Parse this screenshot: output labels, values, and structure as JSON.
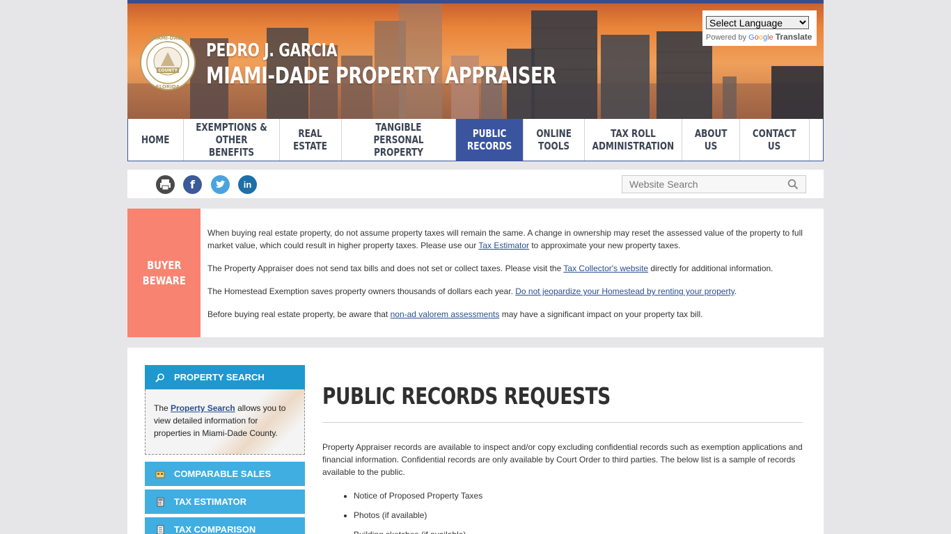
{
  "header": {
    "appraiser_name": "PEDRO J. GARCIA",
    "office_name": "MIAMI-DADE PROPERTY APPRAISER",
    "seal_top_text": "MIAMI-DADE",
    "seal_mid_text": "COUNTY",
    "seal_bottom_text": "FLORIDA",
    "translate": {
      "select_label": "Select Language",
      "powered_by": "Powered by",
      "google": "Google",
      "translate_label": "Translate"
    }
  },
  "nav": {
    "items": [
      {
        "label": "HOME"
      },
      {
        "label": "EXEMPTIONS &\nOTHER BENEFITS"
      },
      {
        "label": "REAL\nESTATE"
      },
      {
        "label": "TANGIBLE\nPERSONAL PROPERTY"
      },
      {
        "label": "PUBLIC\nRECORDS"
      },
      {
        "label": "ONLINE\nTOOLS"
      },
      {
        "label": "TAX ROLL\nADMINISTRATION"
      },
      {
        "label": "ABOUT\nUS"
      },
      {
        "label": "CONTACT\nUS"
      }
    ],
    "active_index": 4
  },
  "toolbar": {
    "social": [
      {
        "icon": "print-icon",
        "glyph": "⎙",
        "color": "#4a4a4a"
      },
      {
        "icon": "facebook-icon",
        "glyph": "f",
        "color": "#3b5a9a"
      },
      {
        "icon": "twitter-icon",
        "glyph": "t",
        "color": "#4aa3df"
      },
      {
        "icon": "linkedin-icon",
        "glyph": "in",
        "color": "#1e6fa6"
      }
    ],
    "search_placeholder": "Website Search"
  },
  "buyer_beware": {
    "label": "BUYER\nBEWARE",
    "p1_pre": "When buying real estate property, do not assume property taxes will remain the same. A change in ownership may reset the assessed value of the property to full market value, which could result in higher property taxes. Please use our ",
    "p1_link": "Tax Estimator",
    "p1_post": " to approximate your new property taxes.",
    "p2_pre": "The Property Appraiser does not send tax bills and does not set or collect taxes. Please visit the ",
    "p2_link": "Tax Collector's website",
    "p2_post": " directly for additional information.",
    "p3_pre": "The Homestead Exemption saves property owners thousands of dollars each year. ",
    "p3_link": "Do not jeopardize your Homestead by renting your property",
    "p3_post": ".",
    "p4_pre": "Before buying real estate property, be aware that ",
    "p4_link": "non-ad valorem assessments",
    "p4_post": " may have a significant impact on your property tax bill."
  },
  "sidebar": {
    "property_search": {
      "title": "PROPERTY SEARCH",
      "body_pre": "The ",
      "body_link": "Property Search",
      "body_post": " allows you to view detailed information for properties in Miami-Dade County."
    },
    "buttons": [
      {
        "label": "COMPARABLE SALES",
        "icon": "comparable-sales-icon"
      },
      {
        "label": "TAX ESTIMATOR",
        "icon": "calculator-icon"
      },
      {
        "label": "TAX COMPARISON",
        "icon": "document-icon"
      }
    ]
  },
  "main": {
    "title": "PUBLIC RECORDS REQUESTS",
    "intro": "Property Appraiser records are available to inspect and/or copy excluding confidential records such as exemption applications and financial information. Confidential records are only available by Court Order to third parties. The below list is a sample of records available to the public.",
    "records": [
      "Notice of Proposed Property Taxes",
      "Photos (if available)",
      "Building sketches (if available)"
    ]
  },
  "colors": {
    "nav_active": "#3a54a0",
    "buyer_beware": "#f88370",
    "sidebar_button": "#40aee0",
    "sidebar_header": "#1f98cf"
  }
}
